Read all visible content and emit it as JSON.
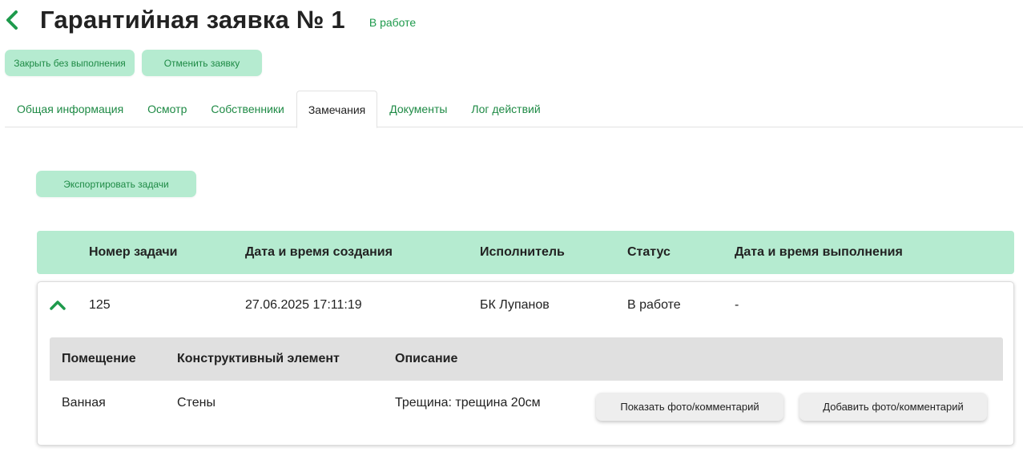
{
  "header": {
    "title": "Гарантийная заявка № 1",
    "status": "В работе",
    "back_icon": "chevron-left-icon"
  },
  "actions": {
    "close_label": "Закрыть без выполнения",
    "cancel_label": "Отменить заявку"
  },
  "tabs": [
    {
      "label": "Общая информация",
      "active": false
    },
    {
      "label": "Осмотр",
      "active": false
    },
    {
      "label": "Собственники",
      "active": false
    },
    {
      "label": "Замечания",
      "active": true
    },
    {
      "label": "Документы",
      "active": false
    },
    {
      "label": "Лог действий",
      "active": false
    }
  ],
  "export_label": "Экспортировать задачи",
  "table": {
    "columns": [
      "Номер задачи",
      "Дата и время создания",
      "Исполнитель",
      "Статус",
      "Дата и время выполнения"
    ],
    "rows": [
      {
        "task_number": "125",
        "created": "27.06.2025 17:11:19",
        "executor": "БК Лупанов",
        "status": "В работе",
        "completed": "-",
        "expanded": true,
        "details": {
          "columns": [
            "Помещение",
            "Конструктивный элемент",
            "Описание"
          ],
          "items": [
            {
              "room": "Ванная",
              "element": "Стены",
              "description": "Трещина: трещина 20см",
              "show_button": "Показать фото/комментарий",
              "add_button": "Добавить фото/комментарий"
            }
          ]
        }
      }
    ]
  },
  "colors": {
    "accent_green": "#1e9a4c",
    "light_green": "#b5ebd0",
    "detail_header_grey": "#e0e0e0"
  }
}
